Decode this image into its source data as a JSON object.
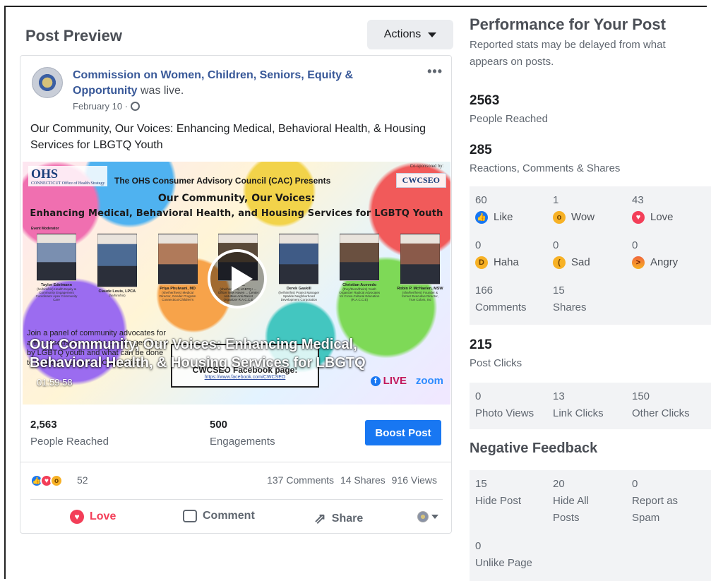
{
  "post_preview": {
    "title": "Post Preview",
    "actions_label": "Actions"
  },
  "post": {
    "page_name": "Commission on Women, Children, Seniors, Equity & Opportunity",
    "status": "was live.",
    "date": "February 10 ·",
    "more": "•••",
    "text": "Our Community, Our Voices: Enhancing Medical, Behavioral Health, & Housing Services for LBGTQ Youth"
  },
  "video": {
    "logo": "OHS",
    "logo_sub": "CONNECTICUT Office of Health Strategy",
    "presents": "The OHS Consumer Advisory Council (CAC) Presents",
    "cosponsor": "Co-sponsored by:",
    "cosponsor_logo": "CWCSEO",
    "title_line1": "Our Community, Our Voices:",
    "title_line2": "Enhancing Medical, Behavioral Health, and Housing Services for LGBTQ Youth",
    "moderator_tag": "Event Moderator",
    "panelists": [
      {
        "name": "Taylor Edelmann",
        "role": "(he/him/his) Health Equity & Community Engagement Coordinator Apex Community Care",
        "color": "#7a8fb0"
      },
      {
        "name": "Claude Louis, LPCA",
        "role": "(he/him/his)",
        "color": "#4c6b94"
      },
      {
        "name": "Priya Phulwani, MD",
        "role": "(she/her/hers) Medical Director, Gender Program Connecticut Children's",
        "color": "#b07a5a"
      },
      {
        "name": "Mara ...",
        "role": "(she/her/hers) LGBTQ+ ... Officer New Haven ... Center Anti-Bias Anti-Racist Organizer R.A.C.C.E",
        "color": "#5a4a3a"
      },
      {
        "name": "Derek Gaskill",
        "role": "(he/him/his) Project Manager Sparkle Neighborhood Development Corporation",
        "color": "#3f5b86"
      },
      {
        "name": "Christian Acevedo",
        "role": "(they/them/theirs) Youth Organizer Radical Advocates for Cross-Cultural Education (R.A.C.C.E)",
        "color": "#6a5040"
      },
      {
        "name": "Robin P. McHaelen, MSW",
        "role": "(she/her/hers) Founder & former Executive Director, True Colors, Inc",
        "color": "#8a5a4a"
      }
    ],
    "description": "Join a panel of community advocates for a live discussion on the challenges faced by LGBTQ youth and what can be done to address barriers in Connecticut.",
    "fb_heading": "CWCSEO Facebook page:",
    "fb_url": "https://www.facebook.com/CWCSEO",
    "fb_letter": "f",
    "live_label": "LIVE",
    "zoom_label": "zoom",
    "overlay_title": "Our Community, Our Voices: Enhancing Medical, Behavioral Health, & Housing Services for LBGTQ",
    "duration": "01:59:58"
  },
  "stats": {
    "reached_value": "2,563",
    "reached_label": "People Reached",
    "engagements_value": "500",
    "engagements_label": "Engagements",
    "boost_label": "Boost Post"
  },
  "reactions_bar": {
    "count": "52",
    "comments": "137 Comments",
    "shares": "14 Shares",
    "views": "916 Views"
  },
  "post_actions": {
    "love": "Love",
    "comment": "Comment",
    "share": "Share"
  },
  "performance": {
    "title": "Performance for Your Post",
    "subtitle": "Reported stats may be delayed from what appears on posts.",
    "people_reached_value": "2563",
    "people_reached_label": "People Reached",
    "rcs_value": "285",
    "rcs_label": "Reactions, Comments & Shares",
    "reactions": [
      {
        "value": "60",
        "label": "Like",
        "icon": "like-icon"
      },
      {
        "value": "1",
        "label": "Wow",
        "icon": "wow-icon"
      },
      {
        "value": "43",
        "label": "Love",
        "icon": "love-icon"
      },
      {
        "value": "0",
        "label": "Haha",
        "icon": "haha-icon"
      },
      {
        "value": "0",
        "label": "Sad",
        "icon": "sad-icon"
      },
      {
        "value": "0",
        "label": "Angry",
        "icon": "angry-icon"
      }
    ],
    "comments_value": "166",
    "comments_label": "Comments",
    "shares_value": "15",
    "shares_label": "Shares",
    "post_clicks_value": "215",
    "post_clicks_label": "Post Clicks",
    "clicks": [
      {
        "value": "0",
        "label": "Photo Views"
      },
      {
        "value": "13",
        "label": "Link Clicks"
      },
      {
        "value": "150",
        "label": "Other Clicks"
      }
    ],
    "negative_title": "Negative Feedback",
    "negative": [
      {
        "value": "15",
        "label": "Hide Post"
      },
      {
        "value": "20",
        "label": "Hide All Posts"
      },
      {
        "value": "0",
        "label": "Report as Spam"
      },
      {
        "value": "0",
        "label": "Unlike Page"
      }
    ]
  }
}
